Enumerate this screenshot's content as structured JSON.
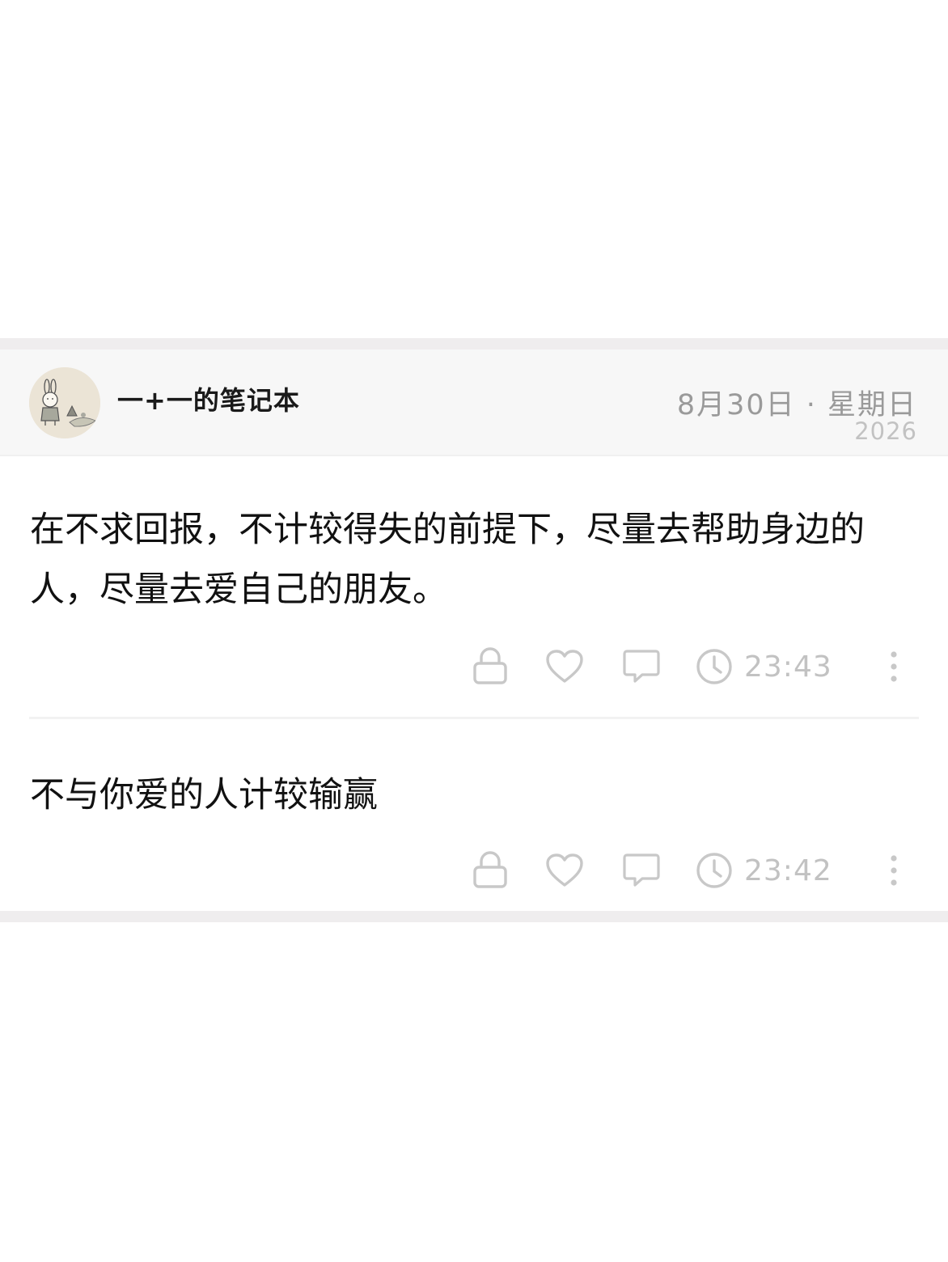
{
  "header": {
    "author": "一+一的笔记本",
    "date": "8月30日 · 星期日",
    "year": "2026"
  },
  "entries": [
    {
      "text": "在不求回报，不计较得失的前提下，尽量去帮助身边的人，尽量去爱自己的朋友。",
      "time": "23:43"
    },
    {
      "text": "不与你爱的人计较输赢",
      "time": "23:42"
    }
  ],
  "icons": {
    "lock": "lock-icon",
    "like": "heart-icon",
    "comment": "comment-icon",
    "time": "clock-icon",
    "more": "more-vertical-icon"
  },
  "colors": {
    "header_bg": "#f7f7f7",
    "separator": "#efedee",
    "icon": "#c8c8c8",
    "muted_text": "#9a9a9a"
  }
}
